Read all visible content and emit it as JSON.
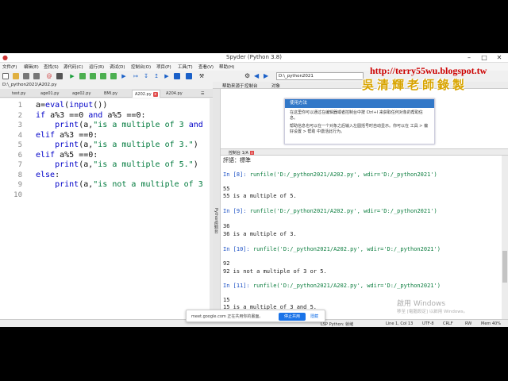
{
  "window": {
    "title": "Spyder (Python 3.8)"
  },
  "menu": [
    "文件(F)",
    "编辑(E)",
    "查找(S)",
    "源代码(C)",
    "运行(R)",
    "调试(D)",
    "控制台(O)",
    "项目(P)",
    "工具(T)",
    "查看(V)",
    "帮助(H)"
  ],
  "editor": {
    "path": "D:\\_python2021\\A202.py",
    "tabs": [
      {
        "label": "test.py",
        "active": false
      },
      {
        "label": "age01.py",
        "active": false
      },
      {
        "label": "age02.py",
        "active": false
      },
      {
        "label": "BMI.py",
        "active": false
      },
      {
        "label": "A202.py",
        "active": true
      },
      {
        "label": "A204.py",
        "active": false
      }
    ],
    "lines": [
      {
        "n": "1",
        "t": "a=eval(input())"
      },
      {
        "n": "2",
        "t": "if a%3 ==0 and a%5 ==0:"
      },
      {
        "n": "3",
        "t": "    print(a,\"is a multiple of 3 and"
      },
      {
        "n": "4",
        "t": "elif a%3 ==0:"
      },
      {
        "n": "5",
        "t": "    print(a,\"is a multiple of 3.\")"
      },
      {
        "n": "6",
        "t": "elif a%5 ==0:"
      },
      {
        "n": "7",
        "t": "    print(a,\"is a multiple of 5.\")"
      },
      {
        "n": "8",
        "t": "else:"
      },
      {
        "n": "9",
        "t": "    print(a,\"is not a multiple of 3"
      },
      {
        "n": "10",
        "t": ""
      }
    ]
  },
  "help": {
    "path": "D:\\_python2021",
    "tabs": [
      "帮助来源于",
      "控制台",
      "对象"
    ],
    "card_title": "使用方法",
    "card_text1": "在这里你可以通过在编辑器或者控制台中按 Ctrl+I 来获取任何对象的帮助信息。",
    "card_text2": "帮助信息也可以在一个对象之后输入左圆括号时自动显示。你可以在 工具 > 偏好设置 > 帮助 中激活此行为。",
    "side_label": "Python控制台"
  },
  "console": {
    "tab": "控制台 1/A",
    "header": "評語：標準",
    "lines": [
      {
        "k": "in",
        "p": "In [8]:",
        "c": " runfile('D:/_python2021/A202.py', wdir='D:/_python2021')"
      },
      {
        "k": "out",
        "t": "55"
      },
      {
        "k": "out",
        "t": "55 is a multiple of 5."
      },
      {
        "k": "in",
        "p": "In [9]:",
        "c": " runfile('D:/_python2021/A202.py', wdir='D:/_python2021')"
      },
      {
        "k": "out",
        "t": "36"
      },
      {
        "k": "out",
        "t": "36 is a multiple of 3."
      },
      {
        "k": "in",
        "p": "In [10]:",
        "c": " runfile('D:/_python2021/A202.py', wdir='D:/_python2021')"
      },
      {
        "k": "out",
        "t": "92"
      },
      {
        "k": "out",
        "t": "92 is not a multiple of 3 or 5."
      },
      {
        "k": "in",
        "p": "In [11]:",
        "c": " runfile('D:/_python2021/A202.py', wdir='D:/_python2021')"
      },
      {
        "k": "out",
        "t": "15"
      },
      {
        "k": "out",
        "t": "15 is a multiple of 3 and 5."
      }
    ]
  },
  "status": {
    "lsp": "LSP Python: 就绪",
    "position": "Line 1, Col 13",
    "encoding": "UTF-8",
    "eol": "CRLF",
    "rw": "RW",
    "mem": "Mem 40%"
  },
  "overlay": {
    "blog_url": "http://terry55wu.blogspot.tw",
    "signature": "吳清輝老師錄製",
    "meet_text": "meet.google.com 正在共用你的畫面。",
    "stop_share": "停止共用",
    "hide": "隱藏",
    "activate_title": "啟用 Windows",
    "activate_sub": "移至 [電腦設定] 以啟用 Windows。"
  }
}
